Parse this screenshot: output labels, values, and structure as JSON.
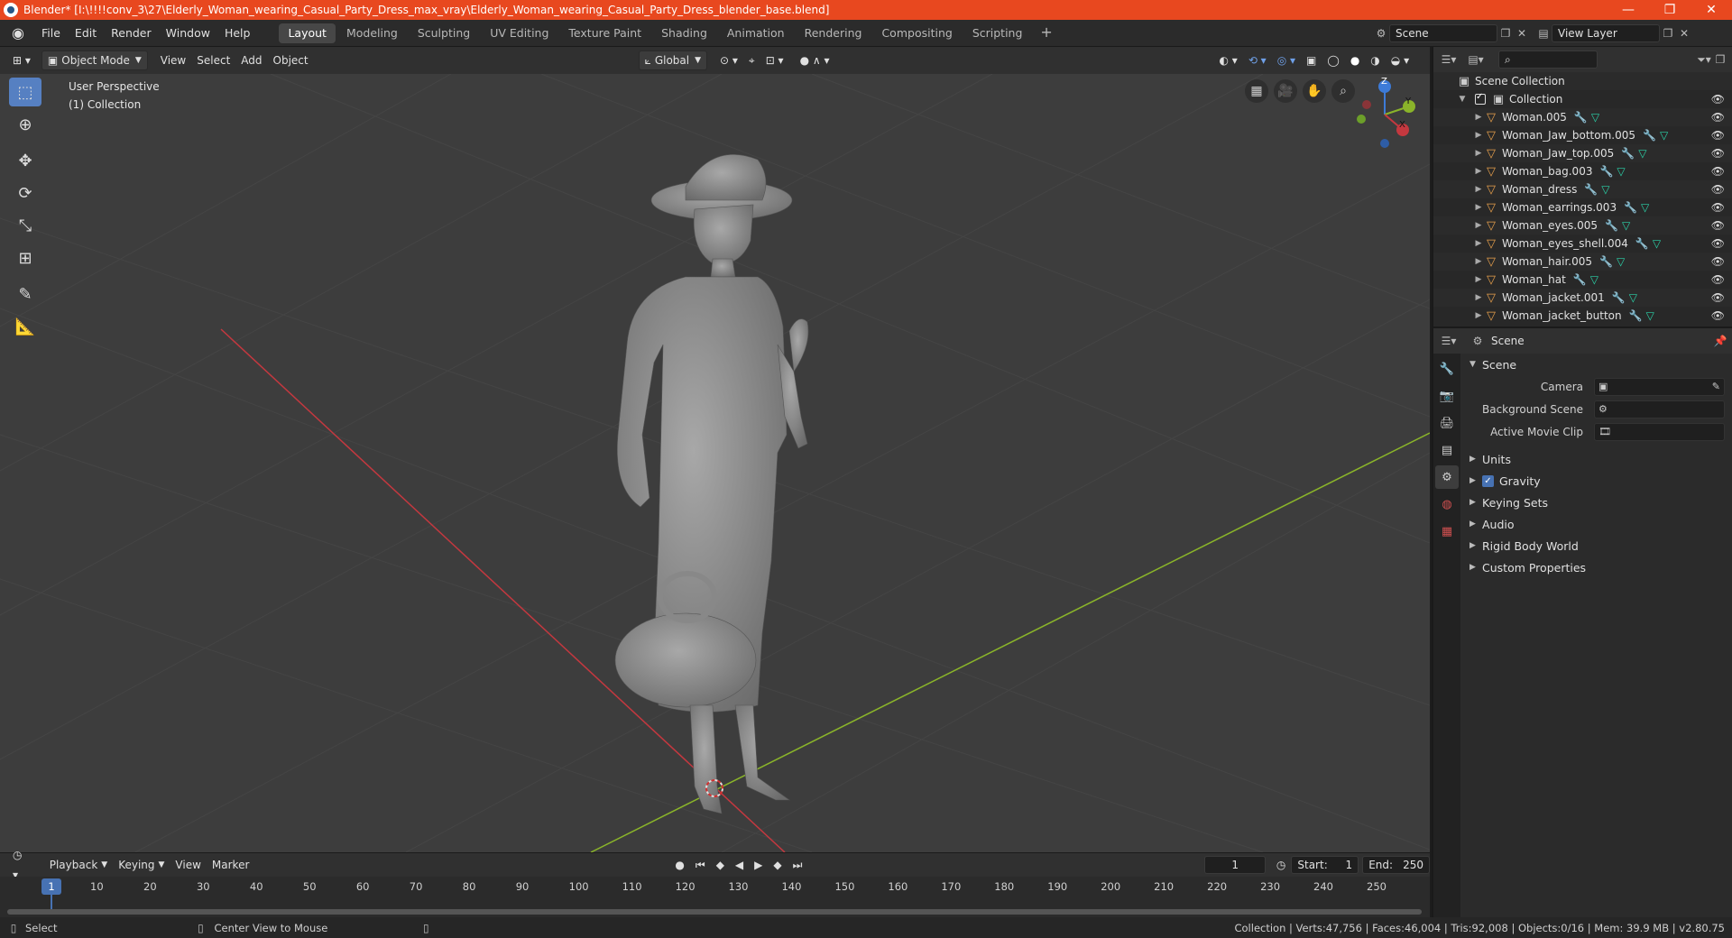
{
  "window": {
    "title": "Blender* [I:\\!!!!conv_3\\27\\Elderly_Woman_wearing_Casual_Party_Dress_max_vray\\Elderly_Woman_wearing_Casual_Party_Dress_blender_base.blend]",
    "minimize": "—",
    "maximize": "❐",
    "close": "✕"
  },
  "menu": [
    "File",
    "Edit",
    "Render",
    "Window",
    "Help"
  ],
  "workspaces": [
    "Layout",
    "Modeling",
    "Sculpting",
    "UV Editing",
    "Texture Paint",
    "Shading",
    "Animation",
    "Rendering",
    "Compositing",
    "Scripting"
  ],
  "active_workspace": "Layout",
  "scene_name": "Scene",
  "view_layer": "View Layer",
  "viewport_header": {
    "mode": "Object Mode",
    "menus": [
      "View",
      "Select",
      "Add",
      "Object"
    ],
    "transform_orientation": "Global"
  },
  "viewport": {
    "perspective_label": "User Perspective",
    "collection_label": "(1) Collection",
    "gizmo": {
      "x": "X",
      "y": "Y",
      "z": "Z"
    }
  },
  "outliner": {
    "scene_collection": "Scene Collection",
    "collection": "Collection",
    "objects": [
      "Woman.005",
      "Woman_Jaw_bottom.005",
      "Woman_Jaw_top.005",
      "Woman_bag.003",
      "Woman_dress",
      "Woman_earrings.003",
      "Woman_eyes.005",
      "Woman_eyes_shell.004",
      "Woman_hair.005",
      "Woman_hat",
      "Woman_jacket.001",
      "Woman_jacket_button"
    ]
  },
  "properties": {
    "header_title": "Scene",
    "panel_title": "Scene",
    "camera_label": "Camera",
    "background_scene_label": "Background Scene",
    "active_movie_clip_label": "Active Movie Clip",
    "sections": [
      "Units",
      "Gravity",
      "Keying Sets",
      "Audio",
      "Rigid Body World",
      "Custom Properties"
    ],
    "gravity_checked": true
  },
  "timeline": {
    "menus": [
      "Playback",
      "Keying",
      "View",
      "Marker"
    ],
    "current_frame": "1",
    "start_label": "Start:",
    "start_value": "1",
    "end_label": "End:",
    "end_value": "250",
    "ruler": [
      "1",
      "10",
      "20",
      "30",
      "40",
      "50",
      "60",
      "70",
      "80",
      "90",
      "100",
      "110",
      "120",
      "130",
      "140",
      "150",
      "160",
      "170",
      "180",
      "190",
      "200",
      "210",
      "220",
      "230",
      "240",
      "250"
    ]
  },
  "status": {
    "left_action": "Select",
    "middle_action": "Center View to Mouse",
    "stats": "Collection | Verts:47,756 | Faces:46,004 | Tris:92,008 | Objects:0/16 | Mem: 39.9 MB | v2.80.75"
  },
  "colors": {
    "title_bar": "#e8481f",
    "accent": "#4772b3",
    "x_axis": "#c4383f",
    "y_axis": "#8ab42a",
    "z_axis": "#3d7bd8"
  }
}
